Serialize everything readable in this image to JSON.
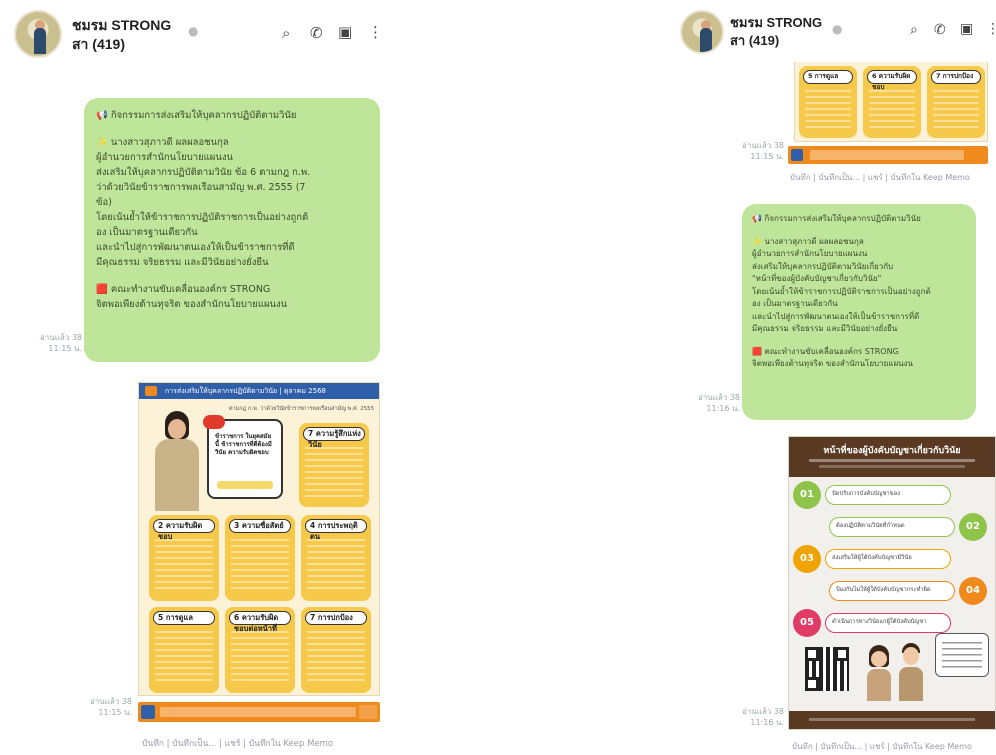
{
  "chat": {
    "title_line1": "ชมรม STRONG",
    "title_line2": "สา (419)",
    "icons": [
      "search-icon",
      "phone-icon",
      "note-icon",
      "more-icon"
    ]
  },
  "left": {
    "message": {
      "title": "📢 กิจกรรมการส่งเสริมให้บุคลากรปฏิบัติตามวินัย",
      "p1_lines": [
        "✨ นางสาวสุภาวดี ผลผลอชนกุล",
        "ผู้อำนวยการสำนักนโยบายแผนงน",
        "ส่งเสริมให้บุคลากรปฏิบัติตามวินัย ข้อ 6 ตามกฎ ก.พ.",
        "ว่าด้วยวินัยข้าราชการพลเรือนสามัญ พ.ศ. 2555 (7",
        "ข้อ)",
        "โดยเน้นย้ำให้ข้าราชการปฏิบัติราชการเป็นอย่างถูกต้",
        "อง เป็นมาตรฐานเดียวกัน",
        "และนำไปสู่การพัฒนาตนเองให้เป็นข้าราชการที่ดี",
        "มีคุณธรรม จริยธรรม และมีวินัยอย่างยั่งยืน"
      ],
      "p2_lines": [
        "🟥 คณะทำงานขับเคลื่อนองค์กร STRONG",
        "จิตพอเพียงต้านทุจริต ของสำนักนโยบายแผนงน"
      ],
      "time": "อ่านแล้ว 38\n11:15 น."
    },
    "infographic": {
      "header": "การส่งเสริมให้บุคลากรปฏิบัติตามวินัย | ตุลาคม 2568",
      "sub": "ตามกฎ ก.พ. ว่าด้วยวินัยข้าราชการพลเรือนสามัญ พ.ศ. 2555",
      "speech": "ข้าราชการ ในยุคสมัยนี้ ข้าราชการที่ดีต้องมีวินัย ความรับผิดชอบ",
      "card_labels": [
        "7 ความรู้สึกแห่งวินัย",
        "2 ความรับผิดชอบ",
        "3 ความซื่อสัตย์",
        "4 การประพฤติตน",
        "5 การดูแล",
        "6 ความรับผิดชอบต่อหน้าที่",
        "7 การปกป้อง"
      ],
      "time": "อ่านแล้ว 38\n11:15 น."
    },
    "footer": "บันทึก | บันทึกเป็น... | แชร์ | บันทึกใน Keep Memo"
  },
  "right": {
    "top_cards": [
      "5 การดูแล",
      "6 ความรับผิดชอบ",
      "7 การปกป้อง"
    ],
    "top_time": "อ่านแล้ว 38\n11:15 น.",
    "top_footer": "บันทึก | บันทึกเป็น... | แชร์ | บันทึกใน Keep Memo",
    "message": {
      "title": "📢 กิจกรรมการส่งเสริมให้บุคลากรปฏิบัติตามวินัย",
      "p1_lines": [
        "✨ นางสาวสุภาวดี ผลผลอชนกุล",
        "ผู้อำนวยการสำนักนโยบายแผนงน",
        "ส่งเสริมให้บุคลากรปฏิบัติตามวินัยเกี่ยวกับ",
        "\"หน้าที่ของผู้บังคับบัญชาเกี่ยวกับวินัย\"",
        "โดยเน้นย้ำให้ข้าราชการปฏิบัติราชการเป็นอย่างถูกต้",
        "อง เป็นมาตรฐานเดียวกัน",
        "และนำไปสู่การพัฒนาตนเองให้เป็นข้าราชการที่ดี",
        "มีคุณธรรม จริยธรรม และมีวินัยอย่างยั่งยืน"
      ],
      "p2_lines": [
        "🟥 คณะทำงานขับเคลื่อนองค์กร STRONG",
        "จิตพอเพียงต้านทุจริต ของสำนักนโยบายแผนงน"
      ],
      "time": "อ่านแล้ว 38\n11:16 น."
    },
    "infographic": {
      "header": "หน้าที่ของผู้บังคับบัญชาเกี่ยวกับวินัย",
      "steps": [
        "01",
        "02",
        "03",
        "04",
        "05"
      ],
      "step_text": [
        "ปัดปรับการบังคับบัญชาของ",
        "ต้องปฏิบัติตามวินัยที่กำหนด",
        "ส่งเสริมให้ผู้ใต้บังคับบัญชามีวินัย",
        "ป้องกันไม่ให้ผู้ใต้บังคับบัญชากระทำผิด",
        "ดำเนินการทางวินัยแก่ผู้ใต้บังคับบัญชา"
      ],
      "time": "อ่านแล้ว 38\n11:16 น."
    },
    "footer": "บันทึก | บันทึกเป็น... | แชร์ | บันทึกใน Keep Memo"
  },
  "colors": {
    "bubble": "#bfe59a",
    "infographic_header": "#2f5fa8",
    "card": "#f7c94a",
    "promo": "#f08a1c",
    "right_header": "#5a3a22"
  }
}
